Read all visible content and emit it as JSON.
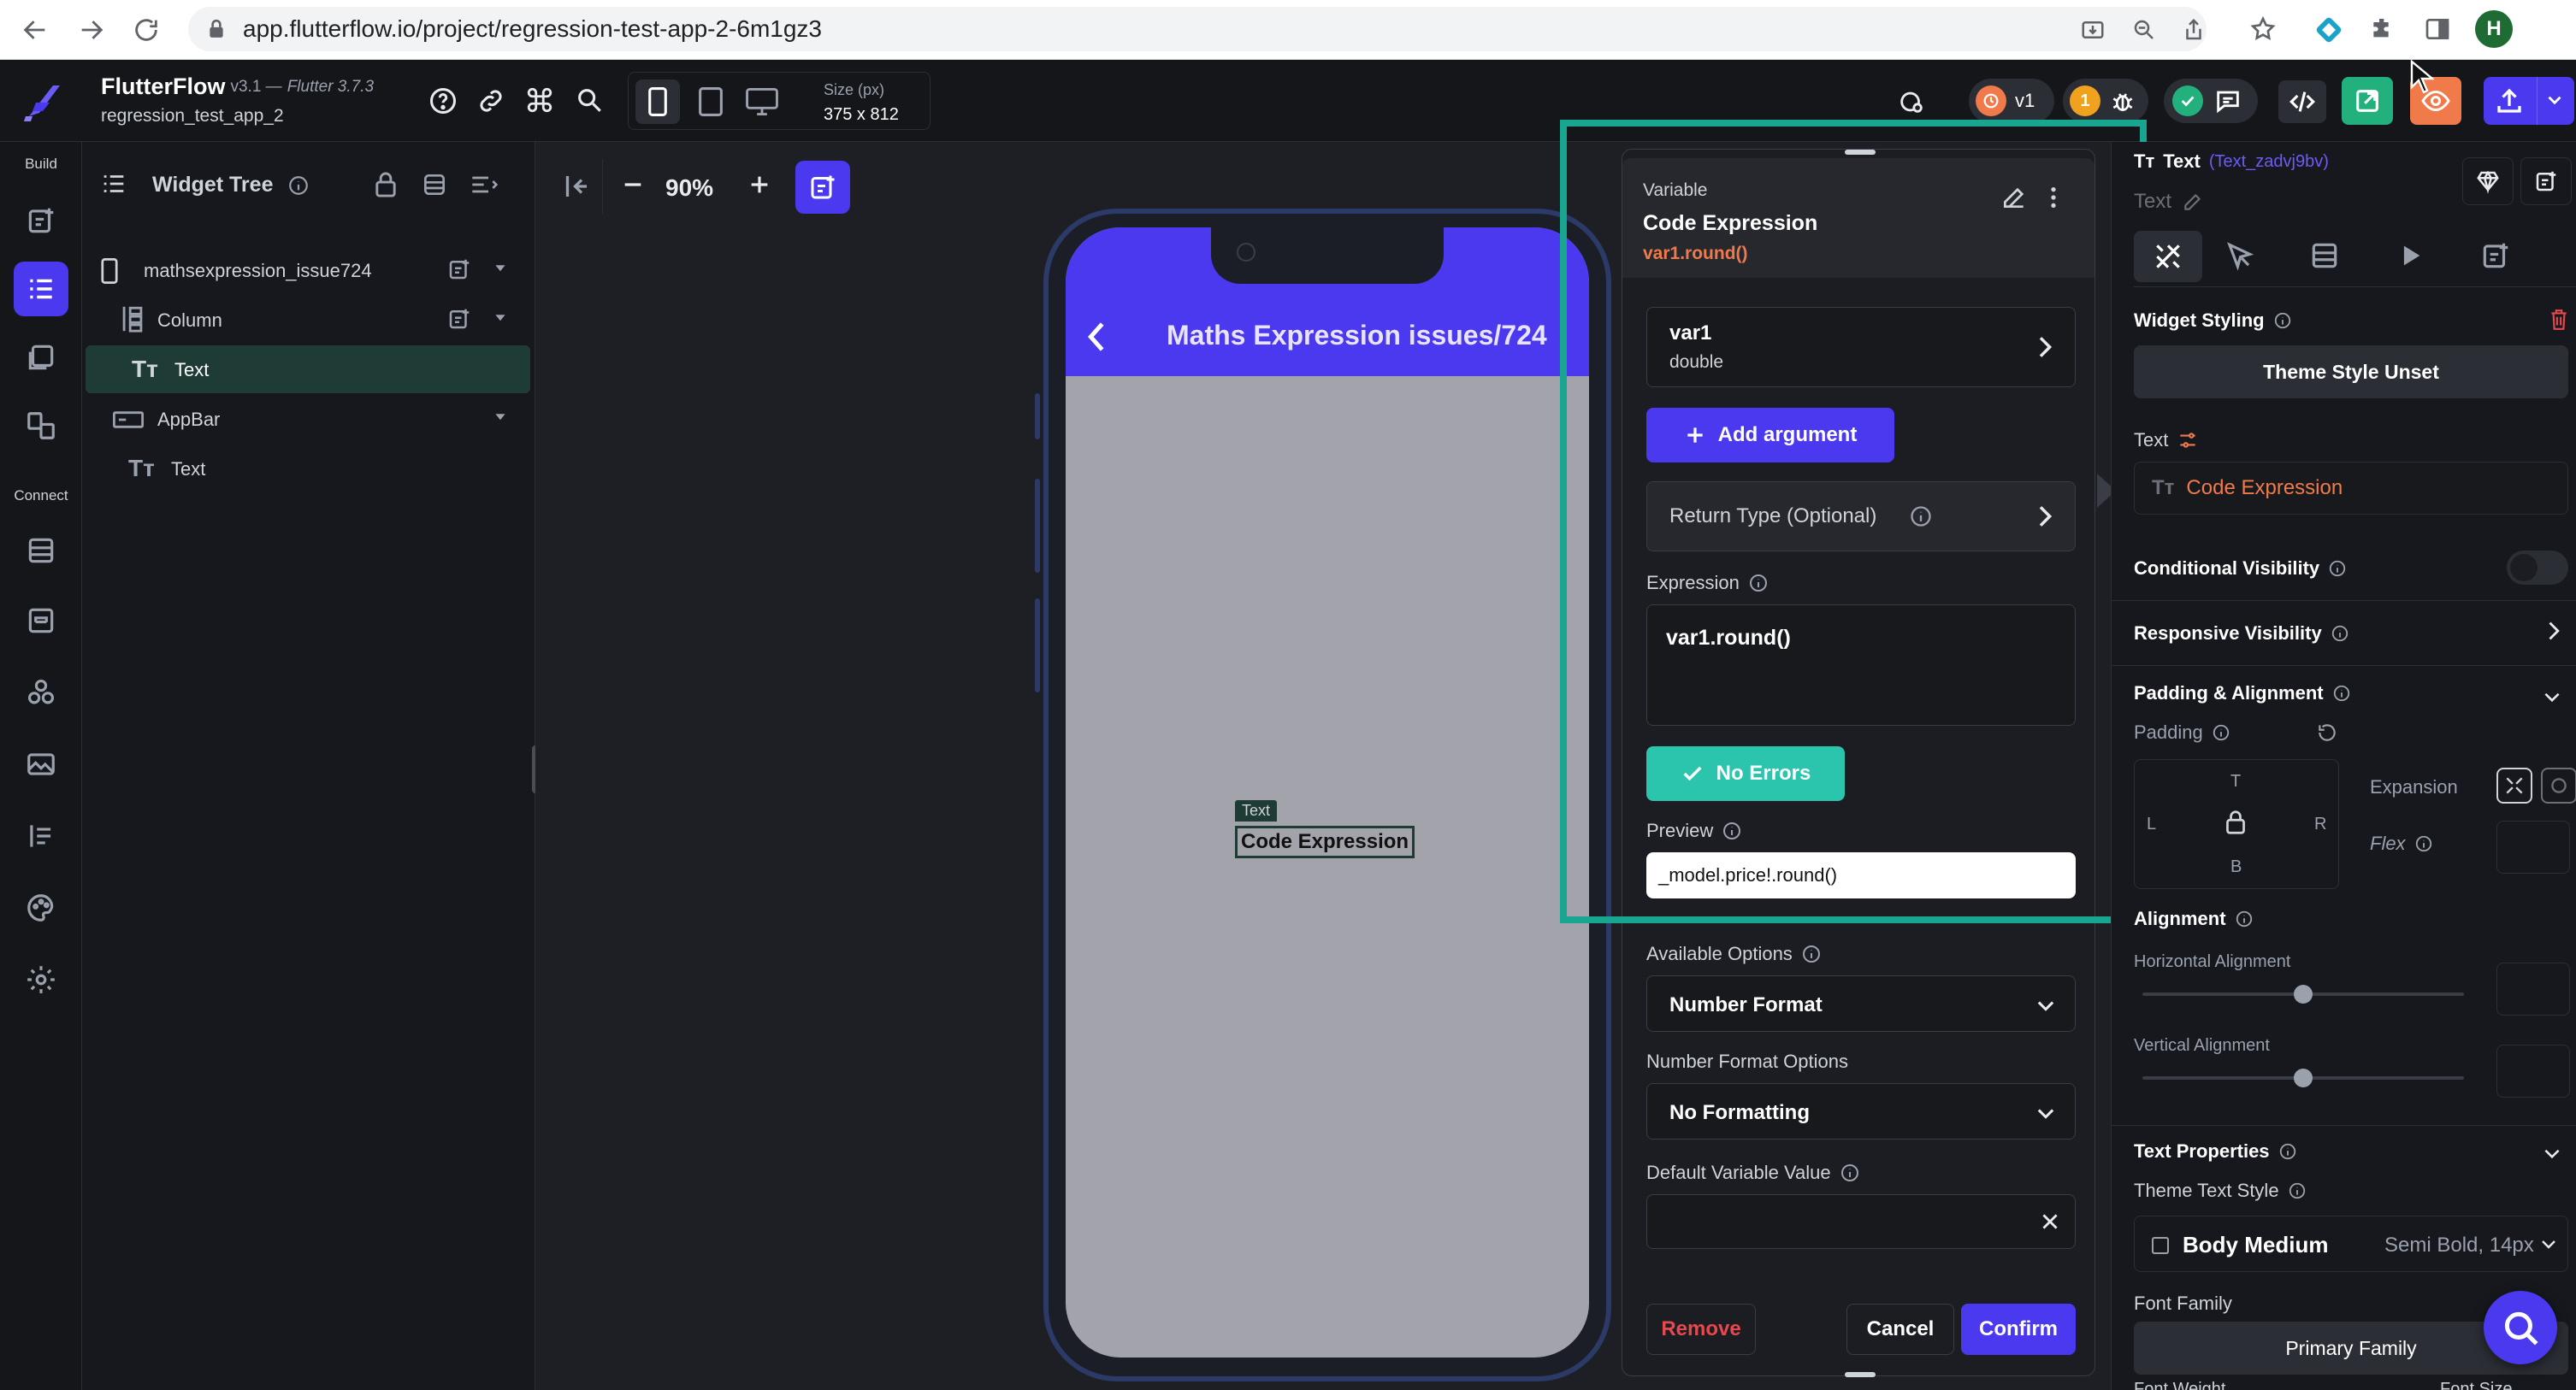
{
  "browser": {
    "url": "app.flutterflow.io/project/regression-test-app-2-6m1gz3",
    "profile_initial": "H"
  },
  "app": {
    "brand": "FlutterFlow",
    "version": "v3.1 — ",
    "flutter": "Flutter 3.7.3",
    "project": "regression_test_app_2",
    "size_label": "Size (px)",
    "size_value": "375 x 812",
    "version_badge": "v1",
    "issue_count": "1"
  },
  "rail": {
    "build_label": "Build",
    "connect_label": "Connect"
  },
  "tree": {
    "title": "Widget Tree",
    "items": [
      {
        "label": "mathsexpression_issue724"
      },
      {
        "label": "Column"
      },
      {
        "label": "Text"
      },
      {
        "label": "AppBar"
      },
      {
        "label": "Text"
      }
    ]
  },
  "canvas": {
    "zoom": "90%",
    "appbar_title": "Maths Expression issues/724",
    "text_tag": "Text",
    "text_content": "Code Expression"
  },
  "modal": {
    "overline": "Variable",
    "title": "Code Expression",
    "subtitle": "var1.round()",
    "arg_name": "var1",
    "arg_type": "double",
    "add_argument": "Add argument",
    "return_type": "Return Type (Optional)",
    "expression_label": "Expression",
    "expression_value": "var1.round()",
    "no_errors": "No Errors",
    "preview_label": "Preview",
    "preview_value": "_model.price!.round()",
    "available_options_label": "Available Options",
    "available_options_value": "Number Format",
    "number_format_label": "Number Format Options",
    "number_format_value": "No Formatting",
    "default_label": "Default Variable Value",
    "default_value": "",
    "remove": "Remove",
    "cancel": "Cancel",
    "confirm": "Confirm"
  },
  "props": {
    "widget_type": "Text",
    "widget_id": "(Text_zadvj9bv)",
    "widget_name": "Text",
    "widget_styling": "Widget Styling",
    "theme_style": "Theme Style Unset",
    "text_label": "Text",
    "text_value": "Code Expression",
    "conditional_visibility": "Conditional Visibility",
    "responsive_visibility": "Responsive Visibility",
    "padding_alignment": "Padding & Alignment",
    "padding": "Padding",
    "pad_t": "T",
    "pad_l": "L",
    "pad_r": "R",
    "pad_b": "B",
    "expansion": "Expansion",
    "flex": "Flex",
    "alignment": "Alignment",
    "horizontal_alignment": "Horizontal Alignment",
    "vertical_alignment": "Vertical Alignment",
    "horizontal_alignment_level": 0.5,
    "vertical_alignment_level": 0.5,
    "text_properties": "Text Properties",
    "theme_text_style": "Theme Text Style",
    "body_medium": "Body Medium",
    "body_medium_meta": "Semi Bold, 14px",
    "font_family": "Font Family",
    "primary_family": "Primary Family",
    "font_weight": "Font Weight",
    "font_size": "Font Size"
  },
  "colors": {
    "accent": "#4b39ef",
    "teal": "#14b8a6",
    "highlight_border": "#19a690",
    "error_red": "#e5484d",
    "orange": "#f07a4a"
  }
}
